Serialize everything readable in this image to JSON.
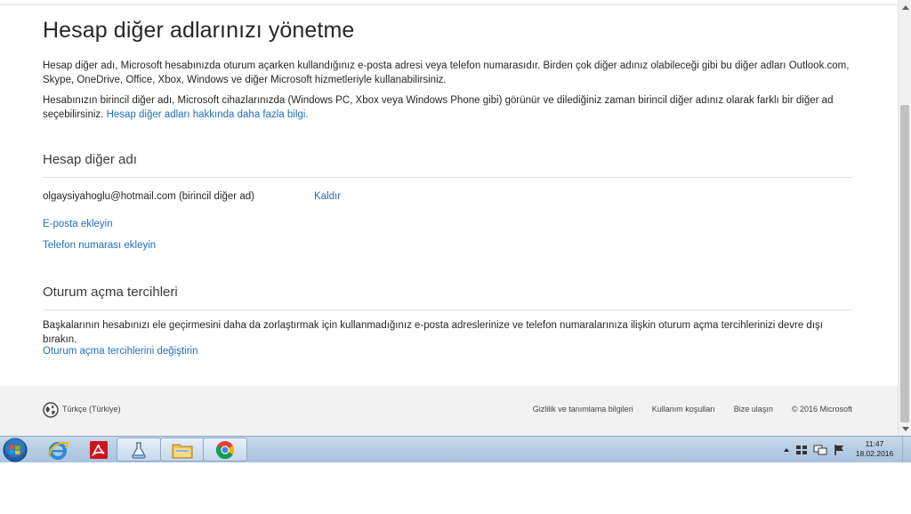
{
  "page": {
    "title": "Hesap diğer adlarınızı yönetme",
    "intro_paragraph": "Hesap diğer adı, Microsoft hesabınızda oturum açarken kullandığınız e-posta adresi veya telefon numarasıdır. Birden çok diğer adınız olabileceği gibi bu diğer adları Outlook.com, Skype, OneDrive, Office, Xbox, Windows ve diğer Microsoft hizmetleriyle kullanabilirsiniz.",
    "primary_paragraph": "Hesabınızın birincil diğer adı, Microsoft cihazlarınızda (Windows PC, Xbox veya Windows Phone gibi) görünür ve dilediğiniz zaman birincil diğer adınız olarak farklı bir diğer ad seçebilirsiniz.",
    "learn_more_link": "Hesap diğer adları hakkında daha fazla bilgi."
  },
  "aliases": {
    "section_title": "Hesap diğer adı",
    "primary_alias": "olgaysiyahoglu@hotmail.com (birincil diğer ad)",
    "remove_link": "Kaldır",
    "add_email_link": "E-posta ekleyin",
    "add_phone_link": "Telefon numarası ekleyin"
  },
  "signin_prefs": {
    "section_title": "Oturum açma tercihleri",
    "description": "Başkalarının hesabınızı ele geçirmesini daha da zorlaştırmak için kullanmadığınız e-posta adreslerinize ve telefon numaralarınıza ilişkin oturum açma tercihlerinizi devre dışı bırakın.",
    "change_link": "Oturum açma tercihlerini değiştirin"
  },
  "footer": {
    "language": "Türkçe (Türkiye)",
    "privacy": "Gizlilik ve tanımlama bilgileri",
    "terms": "Kullanım koşulları",
    "contact": "Bize ulaşın",
    "copyright": "© 2016 Microsoft"
  },
  "taskbar": {
    "time": "11:47",
    "date": "18.02.2016",
    "apps": [
      "windows-start-icon",
      "internet-explorer-icon",
      "acrobat-icon",
      "lab-flask-icon",
      "file-explorer-icon",
      "chrome-icon"
    ]
  },
  "colors": {
    "link": "#1e6fc0",
    "text": "#262626",
    "footer_bg": "#f2f2f2"
  }
}
